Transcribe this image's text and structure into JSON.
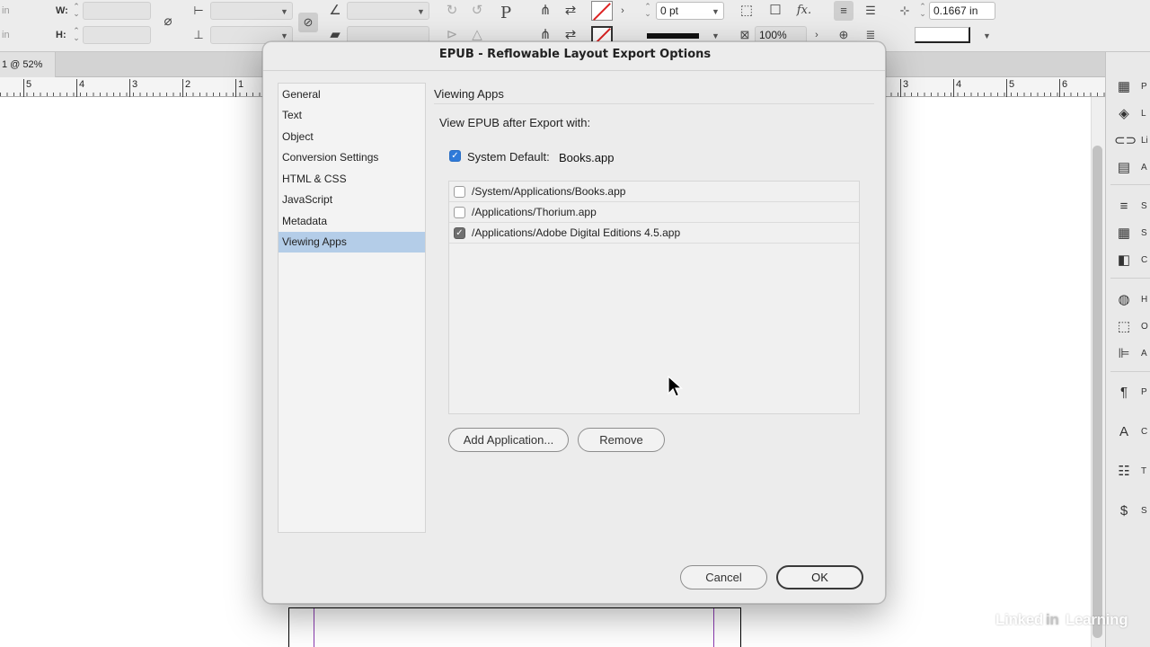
{
  "control_bar": {
    "x_unit": "in",
    "y_unit": "in",
    "w_label": "W:",
    "h_label": "H:",
    "stroke_weight": "0 pt",
    "opacity": "100%",
    "offset": "0.1667 in",
    "fx": "fx."
  },
  "document_tab": {
    "label": "1 @ 52%"
  },
  "ruler": {
    "labels": [
      "5",
      "4",
      "3",
      "2",
      "1",
      "3",
      "4",
      "5",
      "6"
    ]
  },
  "dialog": {
    "title": "EPUB - Reflowable Layout Export Options",
    "nav_items": [
      "General",
      "Text",
      "Object",
      "Conversion Settings",
      "HTML & CSS",
      "JavaScript",
      "Metadata",
      "Viewing Apps"
    ],
    "selected_nav": "Viewing Apps",
    "section_title": "Viewing Apps",
    "subheading": "View EPUB after Export with:",
    "system_default": {
      "label": "System Default:",
      "value": "Books.app",
      "checked": true
    },
    "apps": [
      {
        "path": "/System/Applications/Books.app",
        "checked": false
      },
      {
        "path": "/Applications/Thorium.app",
        "checked": false
      },
      {
        "path": "/Applications/Adobe Digital Editions 4.5.app",
        "checked": true
      }
    ],
    "buttons": {
      "add_application": "Add Application...",
      "remove": "Remove",
      "cancel": "Cancel",
      "ok": "OK"
    }
  },
  "right_panel": {
    "items": [
      {
        "icon": "pages-icon",
        "label": "P"
      },
      {
        "icon": "layers-icon",
        "label": "L"
      },
      {
        "icon": "links-icon",
        "label": "Li"
      },
      {
        "icon": "article-icon",
        "label": "A"
      },
      {
        "icon": "stroke-icon",
        "label": "S"
      },
      {
        "icon": "swatches-icon",
        "label": "S"
      },
      {
        "icon": "cc-libraries-icon",
        "label": "C"
      },
      {
        "icon": "hyperlinks-icon",
        "label": "H"
      },
      {
        "icon": "object-styles-icon",
        "label": "O"
      },
      {
        "icon": "align-icon",
        "label": "A"
      },
      {
        "icon": "paragraph-styles-icon",
        "label": "P"
      },
      {
        "icon": "character-styles-icon",
        "label": "C"
      },
      {
        "icon": "table-icon",
        "label": "T"
      },
      {
        "icon": "stock-icon",
        "label": "S"
      }
    ]
  },
  "watermark": {
    "text_pre": "Linked",
    "text_in": "in",
    "text_post": " Learning"
  },
  "colors": {
    "selection": "#b4cde8",
    "checkbox_blue": "#2f7ad9",
    "dialog_bg": "#ececec"
  }
}
